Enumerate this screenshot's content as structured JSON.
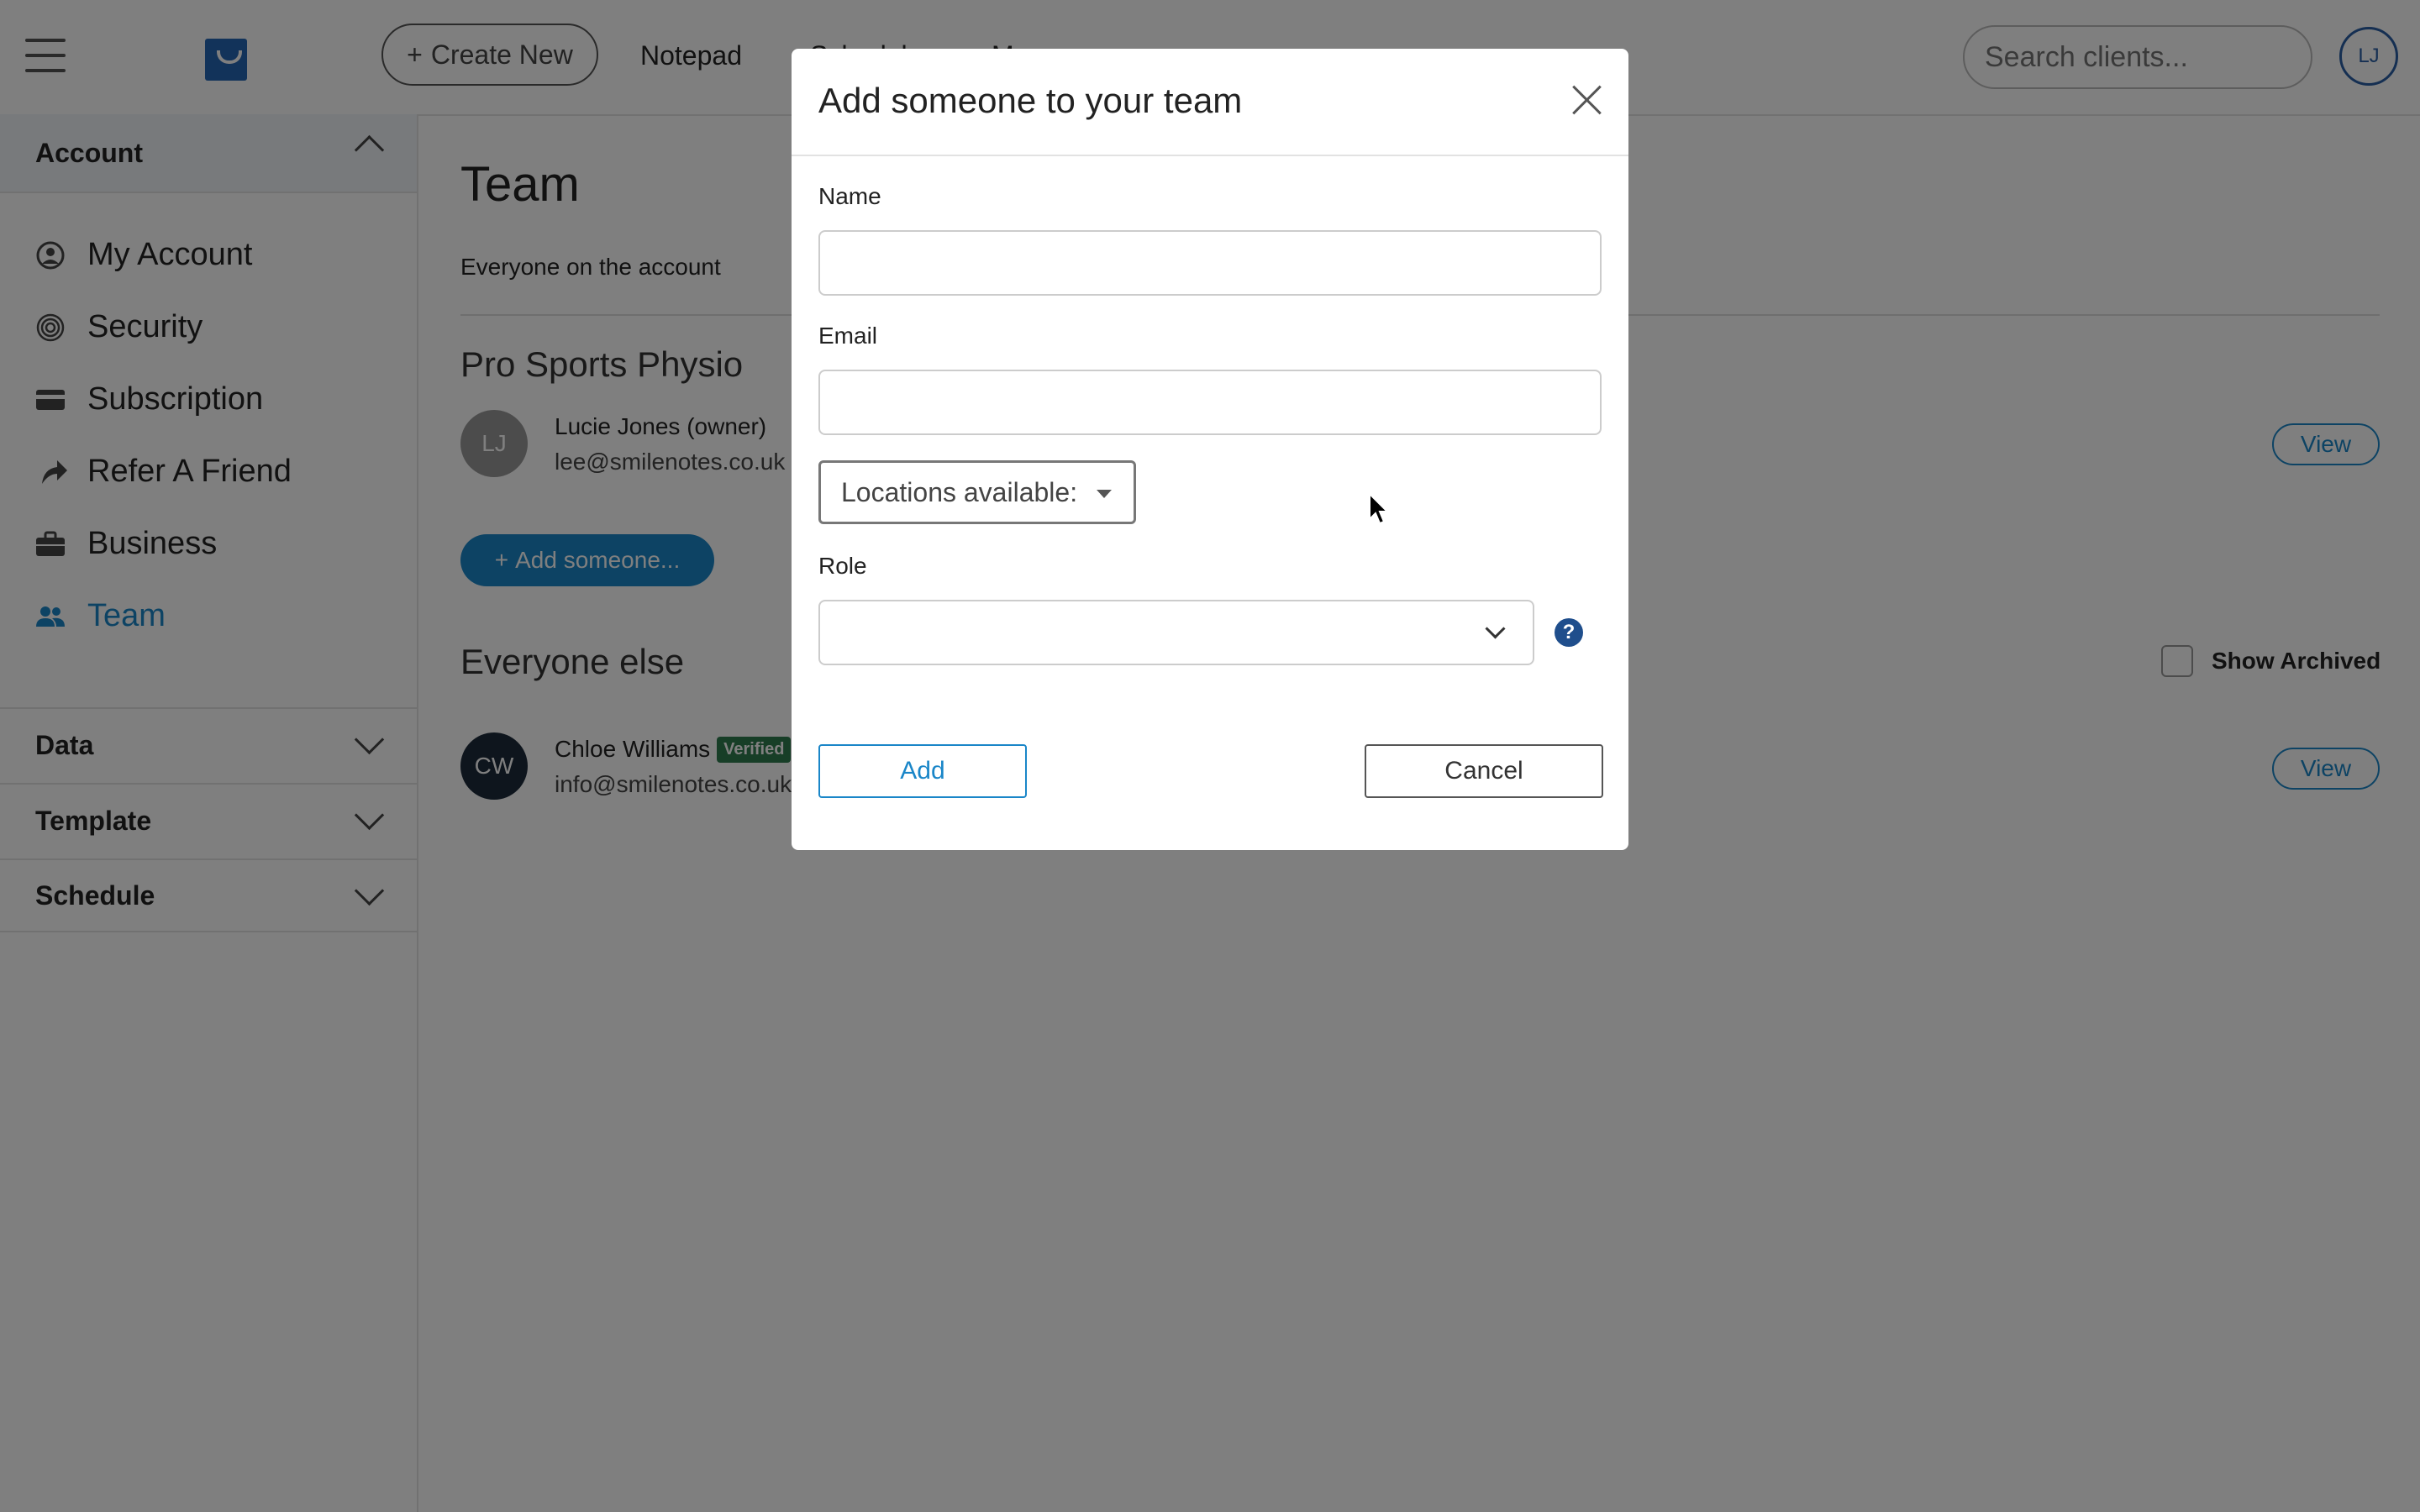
{
  "topbar": {
    "create_new_label": "Create New",
    "nav_links": [
      "Notepad",
      "Schedule",
      "More"
    ],
    "search_placeholder": "Search clients...",
    "user_initials": "LJ"
  },
  "sidebar": {
    "account_header": "Account",
    "items": [
      {
        "label": "My Account",
        "icon": "user-circle-icon"
      },
      {
        "label": "Security",
        "icon": "fingerprint-icon"
      },
      {
        "label": "Subscription",
        "icon": "credit-card-icon"
      },
      {
        "label": "Refer A Friend",
        "icon": "share-arrow-icon"
      },
      {
        "label": "Business",
        "icon": "briefcase-icon"
      },
      {
        "label": "Team",
        "icon": "users-icon"
      }
    ],
    "sections": [
      "Data",
      "Template",
      "Schedule"
    ]
  },
  "main": {
    "title": "Team",
    "subtitle": "Everyone on the account",
    "org_name": "Pro Sports Physio",
    "owner": {
      "initials": "LJ",
      "name": "Lucie Jones (owner)",
      "email": "lee@smilenotes.co.uk"
    },
    "add_someone_label": "Add someone...",
    "everyone_else_title": "Everyone else",
    "show_archived_label": "Show Archived",
    "others": [
      {
        "initials": "CW",
        "name": "Chloe Williams",
        "badge": "Verified",
        "email": "info@smilenotes.co.uk"
      }
    ],
    "view_label": "View"
  },
  "modal": {
    "title": "Add someone to your team",
    "name_label": "Name",
    "name_value": "",
    "email_label": "Email",
    "email_value": "",
    "locations_label": "Locations available:",
    "role_label": "Role",
    "role_value": "",
    "help_glyph": "?",
    "add_label": "Add",
    "cancel_label": "Cancel"
  },
  "colors": {
    "accent": "#1a86c8",
    "brand": "#2467b5",
    "verified": "#2e7d4f",
    "overlay": "rgba(0,0,0,0.5)"
  }
}
